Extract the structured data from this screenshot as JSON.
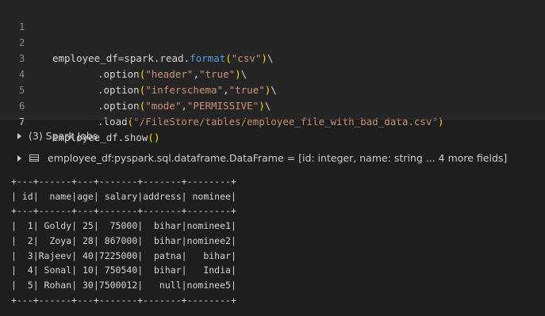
{
  "code": {
    "line_numbers": [
      "1",
      "2",
      "3",
      "4",
      "5",
      "6",
      "7"
    ],
    "line2": {
      "pre": "employee_df=spark.read.",
      "fn": "format",
      "arg": "\"csv\"",
      "cont": "\\"
    },
    "line3": {
      "pre": ".option",
      "arg1": "\"header\"",
      "comma": ",",
      "arg2": "\"true\"",
      "cont": "\\"
    },
    "line4": {
      "pre": ".option",
      "arg1": "\"inferschema\"",
      "comma": ",",
      "arg2": "\"true\"",
      "cont": "\\"
    },
    "line5": {
      "pre": ".option",
      "arg1": "\"mode\"",
      "comma": ",",
      "arg2": "\"PERMISSIVE\"",
      "cont": "\\"
    },
    "line6": {
      "pre": ".load",
      "arg": "\"/FileStore/tables/employee_file_with_bad_data.csv\""
    },
    "line7": {
      "pre": "employee_df.show"
    }
  },
  "paren_open": "(",
  "paren_close": ")",
  "jobs": {
    "label": "(3) Spark Jobs"
  },
  "dataframe": {
    "name": "employee_df:",
    "type": "pyspark.sql.dataframe.DataFrame = [id: integer, name: string ... 4 more fields]"
  },
  "output": {
    "border": "+---+------+---+-------+-------+--------+",
    "header": "| id|  name|age| salary|address| nominee|",
    "rows": [
      "|  1| Goldy| 25|  75000|  bihar|nominee1|",
      "|  2|  Zoya| 28| 867000|  bihar|nominee2|",
      "|  3|Rajeev| 40|7225000|  patna|   bihar|",
      "|  4| Sonal| 10| 750540|  bihar|   India|",
      "|  5| Rohan| 30|7500012|   null|nominee5|"
    ]
  }
}
